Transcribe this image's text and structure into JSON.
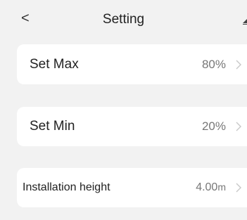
{
  "header": {
    "title": "Setting",
    "back_icon": "<"
  },
  "settings": [
    {
      "label": "Set Max",
      "value": "80%"
    },
    {
      "label": "Set Min",
      "value": "20%"
    },
    {
      "label": "Installation height",
      "value": "4.00",
      "unit": "m"
    }
  ]
}
